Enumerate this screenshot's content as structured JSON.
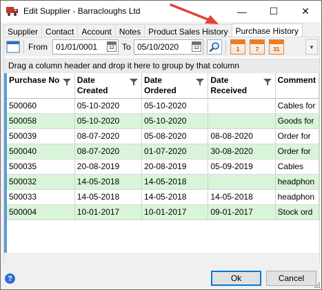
{
  "window": {
    "title": "Edit Supplier - Barracloughs Ltd",
    "minimize": "—",
    "maximize": "☐",
    "close": "✕"
  },
  "tabs": [
    {
      "label": "Supplier",
      "active": false
    },
    {
      "label": "Contact",
      "active": false
    },
    {
      "label": "Account",
      "active": false
    },
    {
      "label": "Notes",
      "active": false
    },
    {
      "label": "Product Sales History",
      "active": false
    },
    {
      "label": "Purchase History",
      "active": true
    }
  ],
  "toolbar": {
    "from_label": "From",
    "from_value": "01/01/0001",
    "to_label": "To",
    "to_value": "05/10/2020",
    "calendar_day": "12",
    "quick_1": "1",
    "quick_7": "7",
    "quick_31": "31"
  },
  "group_panel": "Drag a column header and drop it here to group by that column",
  "grid": {
    "columns": [
      "Purchase No",
      "Date\nCreated",
      "Date\nOrdered",
      "Date\nReceived",
      "Comment"
    ],
    "column_line1": [
      "Purchase No",
      "Date",
      "Date",
      "Date",
      "Comment"
    ],
    "column_line2": [
      "",
      "Created",
      "Ordered",
      "Received",
      ""
    ],
    "rows": [
      [
        "500060",
        "05-10-2020",
        "05-10-2020",
        "",
        "Cables for"
      ],
      [
        "500058",
        "05-10-2020",
        "05-10-2020",
        "",
        "Goods for"
      ],
      [
        "500039",
        "08-07-2020",
        "05-08-2020",
        "08-08-2020",
        "Order for"
      ],
      [
        "500040",
        "08-07-2020",
        "01-07-2020",
        "30-08-2020",
        "Order for"
      ],
      [
        "500035",
        "20-08-2019",
        "20-08-2019",
        "05-09-2019",
        "Cables"
      ],
      [
        "500032",
        "14-05-2018",
        "14-05-2018",
        "",
        "headphon"
      ],
      [
        "500033",
        "14-05-2018",
        "14-05-2018",
        "14-05-2018",
        "headphon"
      ],
      [
        "500004",
        "10-01-2017",
        "10-01-2017",
        "09-01-2017",
        "Stock ord"
      ]
    ]
  },
  "buttons": {
    "ok": "Ok",
    "cancel": "Cancel",
    "help": "?"
  },
  "colors": {
    "alt_row": "#d9f5d9",
    "accent": "#0078d7",
    "arrow": "#e0413a"
  }
}
